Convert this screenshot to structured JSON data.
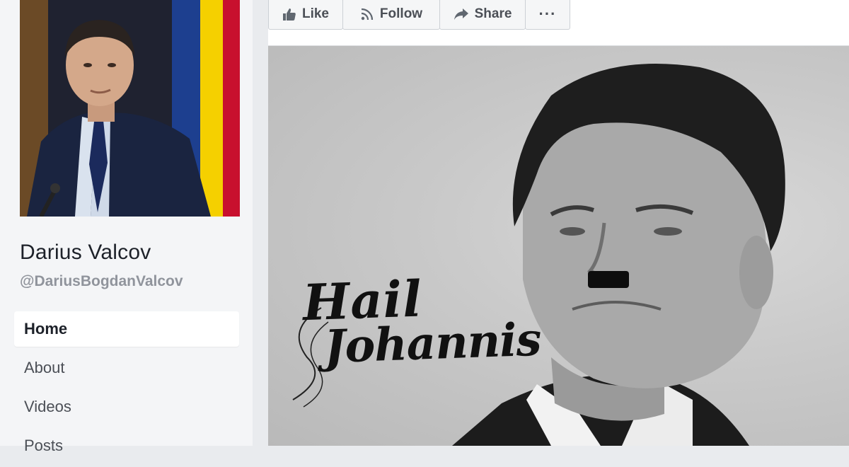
{
  "profile": {
    "name": "Darius Valcov",
    "handle": "@DariusBogdanValcov"
  },
  "nav": {
    "items": [
      {
        "label": "Home",
        "active": true
      },
      {
        "label": "About",
        "active": false
      },
      {
        "label": "Videos",
        "active": false
      },
      {
        "label": "Posts",
        "active": false
      }
    ]
  },
  "actions": {
    "like": "Like",
    "follow": "Follow",
    "share": "Share",
    "more": "···"
  },
  "post": {
    "caption_line1": "Hail",
    "caption_line2": "Johannis"
  },
  "icons": {
    "like": "thumbs-up-icon",
    "follow": "rss-icon",
    "share": "share-arrow-icon",
    "more": "ellipsis-icon"
  },
  "colors": {
    "page_bg": "#e9ebee",
    "text_primary": "#1d2129",
    "text_secondary": "#90949c",
    "button_bg": "#f5f6f7",
    "flag_blue": "#1d3f8f",
    "flag_yellow": "#f5d000",
    "flag_red": "#c8102e"
  }
}
